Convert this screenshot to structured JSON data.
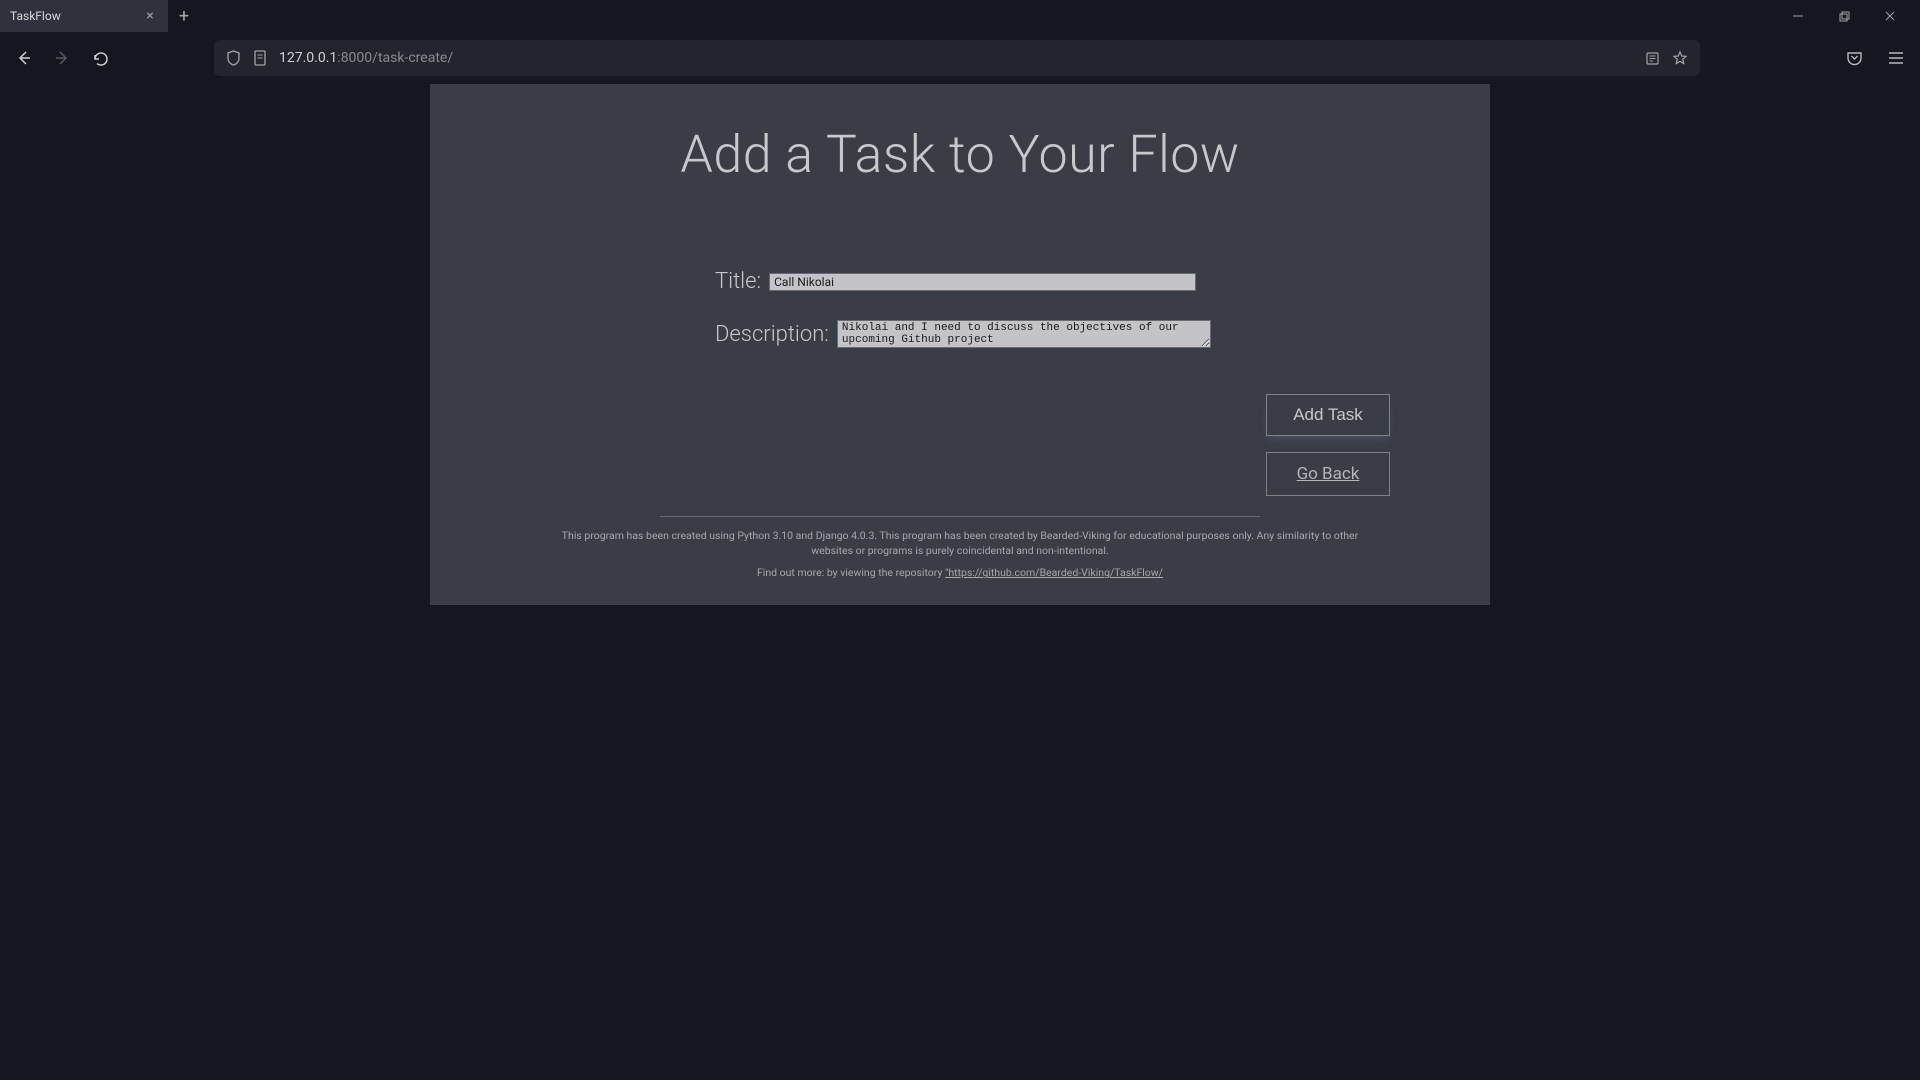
{
  "browser": {
    "tab_title": "TaskFlow",
    "url_host": "127.0.0.1",
    "url_port": ":8000",
    "url_path": "/task-create/"
  },
  "page": {
    "heading": "Add a Task to Your Flow",
    "form": {
      "title_label": "Title:",
      "title_value": "Call Nikolai",
      "description_label": "Description:",
      "description_value": "Nikolai and I need to discuss the objectives of our upcoming Github project",
      "add_button": "Add Task",
      "back_button": "Go Back"
    },
    "footer": {
      "line1": "This program has been created using Python 3.10 and Django 4.0.3. This program has been created by Bearded-Viking for educational purposes only. Any similarity to other websites or programs is purely coincidental and non-intentional.",
      "line2_prefix": "Find out more: by viewing the repository ",
      "repo_url": "\"https://github.com/Bearded-Viking/TaskFlow/"
    }
  }
}
